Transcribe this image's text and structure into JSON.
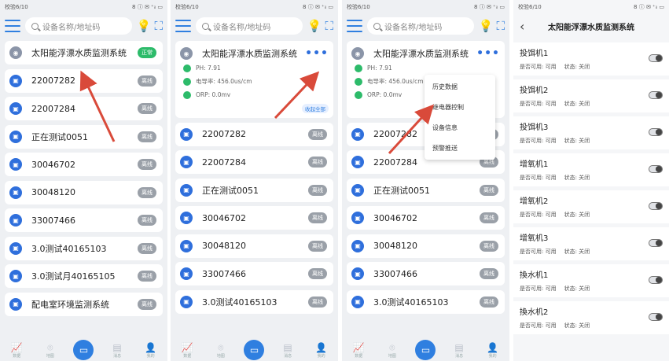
{
  "status_bar": {
    "left": "校验6/10",
    "right": "8 ⓘ ✉ ⁺ᵢₗ ▭"
  },
  "search": {
    "placeholder": "设备名称/地址码"
  },
  "devices_p1": [
    {
      "name": "太阳能浮漂水质监测系统",
      "status": "正常",
      "online": true
    },
    {
      "name": "22007282",
      "status": "离线",
      "online": false
    },
    {
      "name": "22007284",
      "status": "离线",
      "online": false
    },
    {
      "name": "正在测试0051",
      "status": "离线",
      "online": false
    },
    {
      "name": "30046702",
      "status": "离线",
      "online": false
    },
    {
      "name": "30048120",
      "status": "离线",
      "online": false
    },
    {
      "name": "33007466",
      "status": "离线",
      "online": false
    },
    {
      "name": "3.0测试40165103",
      "status": "离线",
      "online": false
    },
    {
      "name": "3.0测试月40165105",
      "status": "离线",
      "online": false
    },
    {
      "name": "配电室环境监测系统",
      "status": "离线",
      "online": false
    }
  ],
  "expanded_device": {
    "name": "太阳能浮漂水质监测系统",
    "more": "•••",
    "params": [
      "PH: 7.91",
      "电导率: 456.0us/cm",
      "ORP: 0.0mv"
    ],
    "collapse_label": "收起全部"
  },
  "devices_p2": [
    {
      "name": "22007282",
      "status": "离线"
    },
    {
      "name": "22007284",
      "status": "离线"
    },
    {
      "name": "正在测试0051",
      "status": "离线"
    },
    {
      "name": "30046702",
      "status": "离线"
    },
    {
      "name": "30048120",
      "status": "离线"
    },
    {
      "name": "33007466",
      "status": "离线"
    },
    {
      "name": "3.0测试40165103",
      "status": "离线"
    }
  ],
  "dropdown_menu": [
    "历史数据",
    "继电器控制",
    "设备信息",
    "预警推送"
  ],
  "bottom_nav": [
    {
      "label": "数据",
      "icon": "chart-icon"
    },
    {
      "label": "地图",
      "icon": "location-icon"
    },
    {
      "label": "",
      "icon": "monitor-icon"
    },
    {
      "label": "消息",
      "icon": "message-icon"
    },
    {
      "label": "我的",
      "icon": "user-icon"
    }
  ],
  "relay_page": {
    "title": "太阳能浮漂水质监测系统",
    "relays": [
      {
        "name": "投饵机1",
        "available": "是否可用: 可用",
        "state": "状态: 关闭"
      },
      {
        "name": "投饵机2",
        "available": "是否可用: 可用",
        "state": "状态: 关闭"
      },
      {
        "name": "投饵机3",
        "available": "是否可用: 可用",
        "state": "状态: 关闭"
      },
      {
        "name": "增氧机1",
        "available": "是否可用: 可用",
        "state": "状态: 关闭"
      },
      {
        "name": "增氧机2",
        "available": "是否可用: 可用",
        "state": "状态: 关闭"
      },
      {
        "name": "增氧机3",
        "available": "是否可用: 可用",
        "state": "状态: 关闭"
      },
      {
        "name": "換水机1",
        "available": "是否可用: 可用",
        "state": "状态: 关闭"
      },
      {
        "name": "換水机2",
        "available": "是否可用: 可用",
        "state": "状态: 关闭"
      }
    ]
  },
  "colors": {
    "accent": "#2f7fe0",
    "online": "#2dbb6a",
    "offline": "#9aa0a8",
    "arrow": "#d94a3a"
  }
}
